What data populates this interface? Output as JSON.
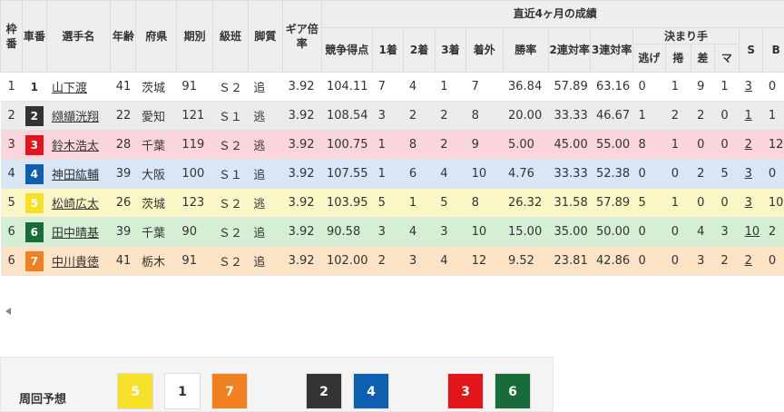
{
  "header": {
    "waku": "枠番",
    "sha": "車番",
    "name": "選手名",
    "age": "年齢",
    "pref": "府県",
    "ki": "期別",
    "klass": "級班",
    "style": "脚質",
    "gear": "ギア倍率",
    "group_title": "直近4ヶ月の成績",
    "score": "競争得点",
    "first": "1着",
    "second": "2着",
    "third": "3着",
    "out": "着外",
    "win_rate": "勝率",
    "rate2": "2連対率",
    "rate3": "3連対率",
    "kimarite": "決まり手",
    "nige": "逃げ",
    "makuri": "捲",
    "sashi": "差",
    "mark": "マ",
    "s": "S",
    "b": "B"
  },
  "colors": {
    "car1": "#ffffff",
    "car2": "#333333",
    "car3": "#e0161b",
    "car4": "#0f5fb0",
    "car5": "#f6e028",
    "car6": "#1a6b3a",
    "car7": "#f08020",
    "row1": "#ffffff",
    "row2": "#ebebeb",
    "row3": "#fbd5dc",
    "row4": "#d8e6f5",
    "row5": "#fbf6c6",
    "row6": "#d4efd4",
    "row7": "#fde3c5"
  },
  "riders": [
    {
      "waku": "1",
      "car": "1",
      "name": "山下渡",
      "age": "41",
      "pref": "茨城",
      "ki": "91",
      "klass": "Ｓ２",
      "style": "追",
      "gear": "3.92",
      "score": "104.11",
      "first": "7",
      "second": "4",
      "third": "1",
      "out": "7",
      "win": "36.84",
      "r2": "57.89",
      "r3": "63.16",
      "nige": "0",
      "makuri": "1",
      "sashi": "9",
      "mark": "1",
      "s": "3",
      "b": "0"
    },
    {
      "waku": "2",
      "car": "2",
      "name": "纐纈洸翔",
      "age": "22",
      "pref": "愛知",
      "ki": "121",
      "klass": "Ｓ１",
      "style": "逃",
      "gear": "3.92",
      "score": "108.54",
      "first": "3",
      "second": "2",
      "third": "2",
      "out": "8",
      "win": "20.00",
      "r2": "33.33",
      "r3": "46.67",
      "nige": "1",
      "makuri": "2",
      "sashi": "2",
      "mark": "0",
      "s": "1",
      "b": "1"
    },
    {
      "waku": "3",
      "car": "3",
      "name": "鈴木浩太",
      "age": "28",
      "pref": "千葉",
      "ki": "119",
      "klass": "Ｓ２",
      "style": "逃",
      "gear": "3.92",
      "score": "100.75",
      "first": "1",
      "second": "8",
      "third": "2",
      "out": "9",
      "win": "5.00",
      "r2": "45.00",
      "r3": "55.00",
      "nige": "8",
      "makuri": "1",
      "sashi": "0",
      "mark": "0",
      "s": "2",
      "b": "12"
    },
    {
      "waku": "4",
      "car": "4",
      "name": "神田紘輔",
      "age": "39",
      "pref": "大阪",
      "ki": "100",
      "klass": "Ｓ１",
      "style": "追",
      "gear": "3.92",
      "score": "107.55",
      "first": "1",
      "second": "6",
      "third": "4",
      "out": "10",
      "win": "4.76",
      "r2": "33.33",
      "r3": "52.38",
      "nige": "0",
      "makuri": "0",
      "sashi": "2",
      "mark": "5",
      "s": "3",
      "b": "0"
    },
    {
      "waku": "5",
      "car": "5",
      "name": "松崎広太",
      "age": "26",
      "pref": "茨城",
      "ki": "123",
      "klass": "Ｓ２",
      "style": "逃",
      "gear": "3.92",
      "score": "103.95",
      "first": "5",
      "second": "1",
      "third": "5",
      "out": "8",
      "win": "26.32",
      "r2": "31.58",
      "r3": "57.89",
      "nige": "5",
      "makuri": "1",
      "sashi": "0",
      "mark": "0",
      "s": "3",
      "b": "10"
    },
    {
      "waku": "6",
      "car": "6",
      "name": "田中晴基",
      "age": "39",
      "pref": "千葉",
      "ki": "90",
      "klass": "Ｓ２",
      "style": "追",
      "gear": "3.92",
      "score": "90.58",
      "first": "3",
      "second": "4",
      "third": "3",
      "out": "10",
      "win": "15.00",
      "r2": "35.00",
      "r3": "50.00",
      "nige": "0",
      "makuri": "0",
      "sashi": "4",
      "mark": "3",
      "s": "10",
      "b": "2"
    },
    {
      "waku": "6",
      "car": "7",
      "name": "中川貴徳",
      "age": "41",
      "pref": "栃木",
      "ki": "91",
      "klass": "Ｓ２",
      "style": "追",
      "gear": "3.92",
      "score": "102.00",
      "first": "2",
      "second": "3",
      "third": "4",
      "out": "12",
      "win": "9.52",
      "r2": "23.81",
      "r3": "42.86",
      "nige": "0",
      "makuri": "0",
      "sashi": "3",
      "mark": "2",
      "s": "2",
      "b": "0"
    }
  ],
  "prediction": {
    "label": "周回予想",
    "slots": [
      "5",
      "1",
      "7",
      "2",
      "4",
      "3",
      "6"
    ]
  }
}
